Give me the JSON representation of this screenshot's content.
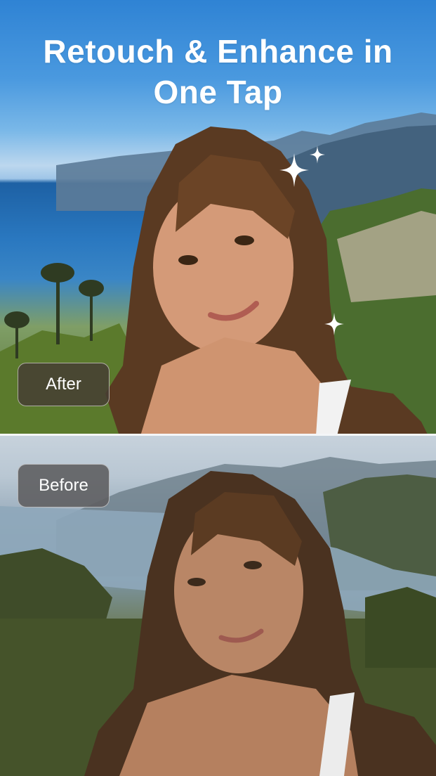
{
  "headline": {
    "line1": "Retouch & Enhance in",
    "line2": "One Tap"
  },
  "labels": {
    "after": "After",
    "before": "Before"
  },
  "icons": {
    "sparkle": "sparkle-icon"
  },
  "colors": {
    "sky_top": "#2f83d4",
    "sea": "#1c5fa2",
    "label_after_bg": "#463e34",
    "label_before_bg": "#5f5f62",
    "text": "#ffffff"
  }
}
